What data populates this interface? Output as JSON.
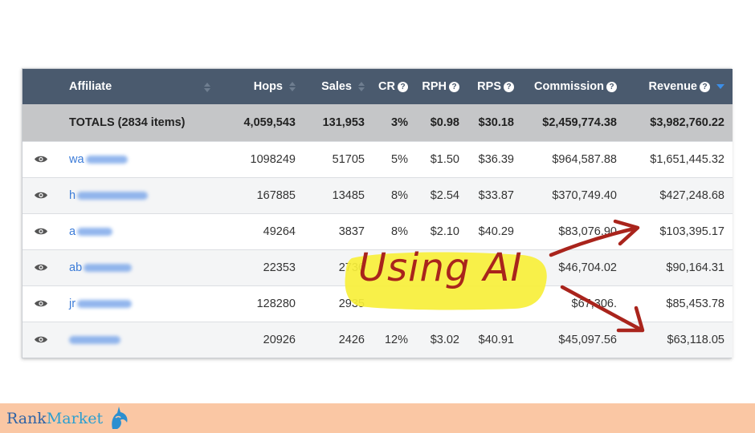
{
  "table": {
    "columns": [
      {
        "key": "eye",
        "label": ""
      },
      {
        "key": "affiliate",
        "label": "Affiliate"
      },
      {
        "key": "hops",
        "label": "Hops"
      },
      {
        "key": "sales",
        "label": "Sales"
      },
      {
        "key": "cr",
        "label": "CR"
      },
      {
        "key": "rph",
        "label": "RPH"
      },
      {
        "key": "rps",
        "label": "RPS"
      },
      {
        "key": "commission",
        "label": "Commission"
      },
      {
        "key": "revenue",
        "label": "Revenue"
      }
    ],
    "totals": {
      "label": "TOTALS (2834 items)",
      "hops": "4,059,543",
      "sales": "131,953",
      "cr": "3%",
      "rph": "$0.98",
      "rps": "$30.18",
      "commission": "$2,459,774.38",
      "revenue": "$3,982,760.22"
    },
    "rows": [
      {
        "affiliate": "wa",
        "hops": "1098249",
        "sales": "51705",
        "cr": "5%",
        "rph": "$1.50",
        "rps": "$36.39",
        "commission": "$964,587.88",
        "revenue": "$1,651,445.32"
      },
      {
        "affiliate": "h",
        "hops": "167885",
        "sales": "13485",
        "cr": "8%",
        "rph": "$2.54",
        "rps": "$33.87",
        "commission": "$370,749.40",
        "revenue": "$427,248.68"
      },
      {
        "affiliate": "a",
        "hops": "49264",
        "sales": "3837",
        "cr": "8%",
        "rph": "$2.10",
        "rps": "$40.29",
        "commission": "$83,076.90",
        "revenue": "$103,395.17"
      },
      {
        "affiliate": "ab",
        "hops": "22353",
        "sales": "2736",
        "cr": "",
        "rph": "",
        "rps": "",
        "commission": "$46,704.02",
        "revenue": "$90,164.31"
      },
      {
        "affiliate": "jr",
        "hops": "128280",
        "sales": "2935",
        "cr": "",
        "rph": "",
        "rps": "",
        "commission": "$67,306.",
        "revenue": "$85,453.78"
      },
      {
        "affiliate": "",
        "hops": "20926",
        "sales": "2426",
        "cr": "12%",
        "rph": "$3.02",
        "rps": "$40.91",
        "commission": "$45,097.56",
        "revenue": "$63,118.05"
      }
    ]
  },
  "annotation": {
    "text": "Using AI",
    "highlight_color": "#f7ef3a",
    "ink_color": "#a9241c"
  },
  "footer": {
    "brand_part1": "Rank",
    "brand_part2": "Market",
    "background": "#fac7a4"
  },
  "colors": {
    "header_bg": "#4a5a6e",
    "totals_bg": "#c5c6c8",
    "link": "#3b7bd8",
    "sort_active": "#3b8ee8"
  },
  "icons": {
    "row_action": "eye-icon",
    "help": "question-circle-icon",
    "sort": "sort-arrows-icon"
  }
}
